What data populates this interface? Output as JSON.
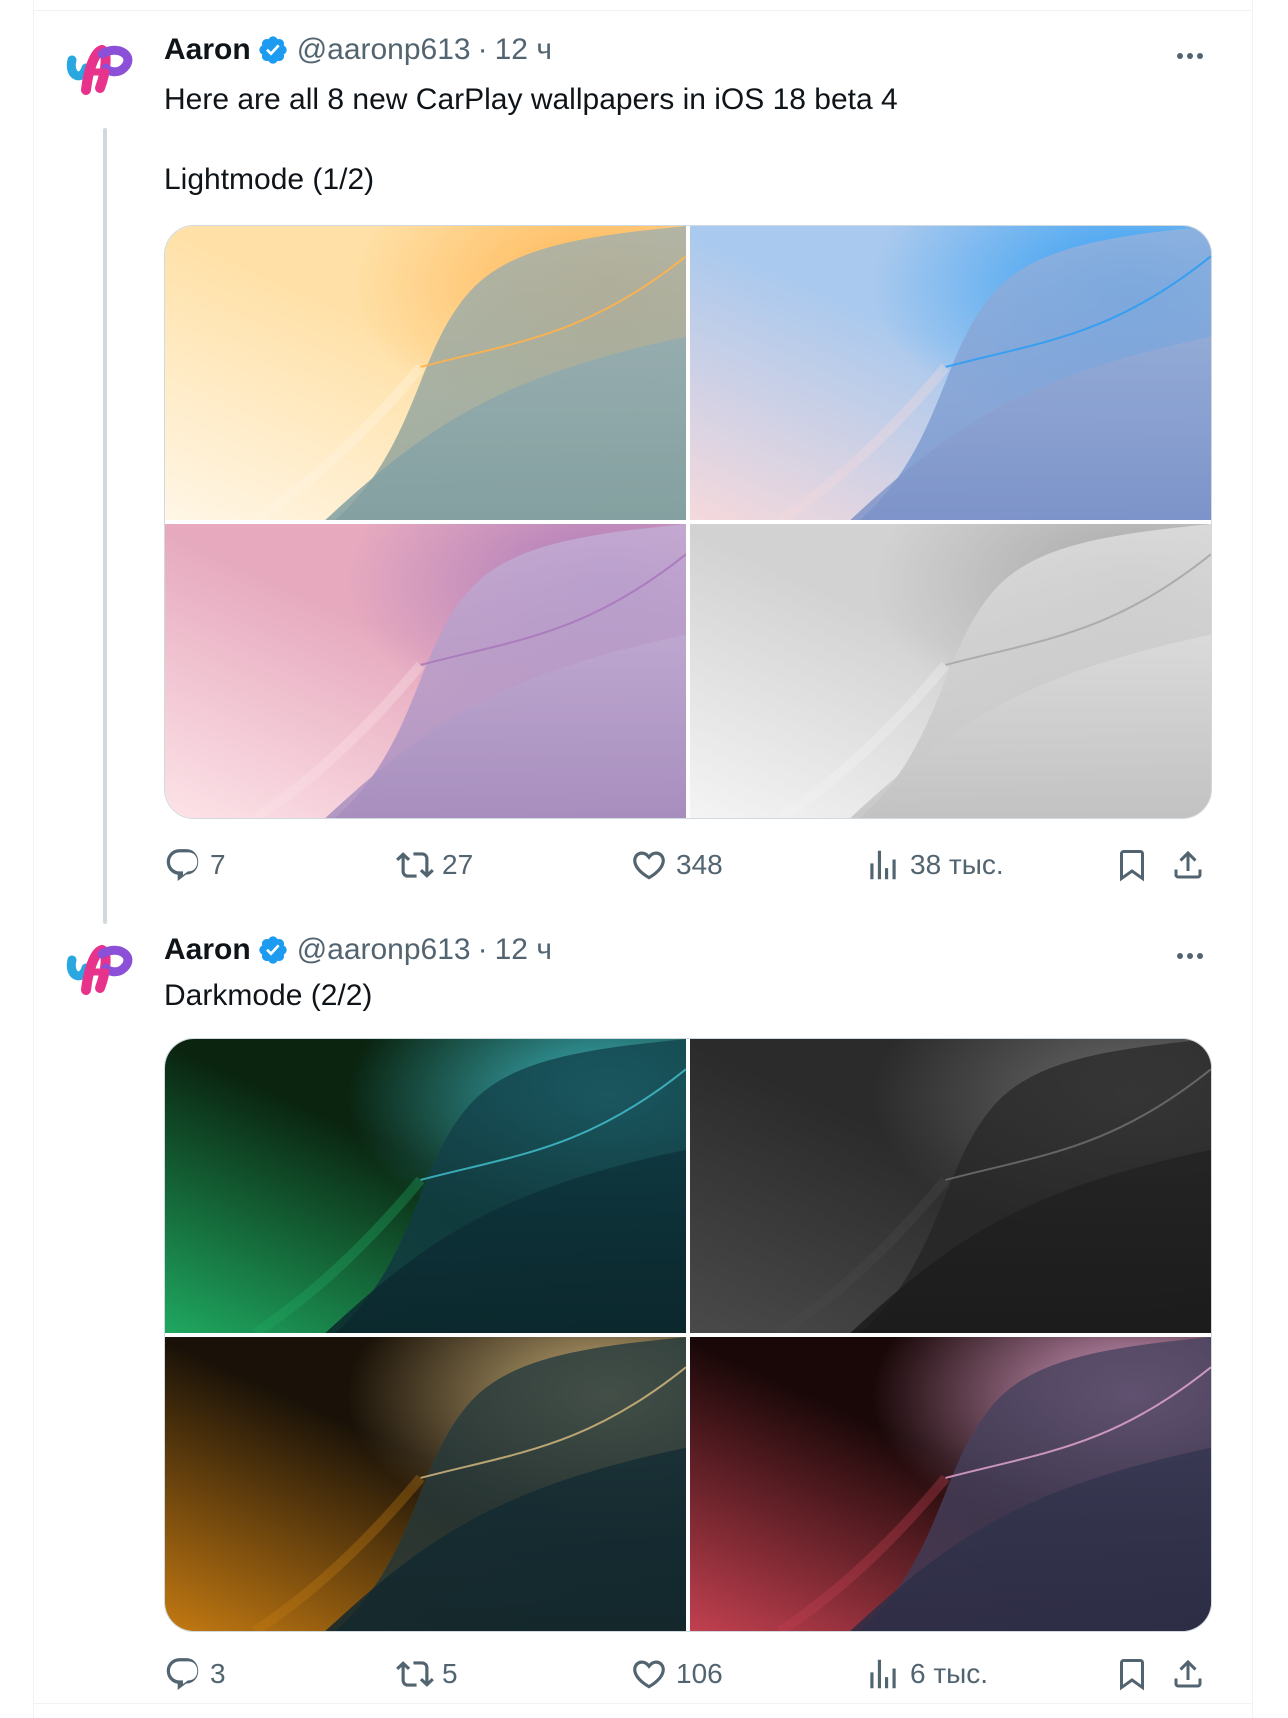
{
  "tweets": [
    {
      "author_name": "Aaron",
      "handle": "@aaronp613",
      "separator": "·",
      "time": "12 ч",
      "text": "Here are all 8 new CarPlay wallpapers in iOS 18 beta 4\n\nLightmode (1/2)",
      "wallpapers": [
        {
          "label": "Lightmode orange wallpaper",
          "colors": [
            "#ffe1a8",
            "#ffb24e",
            "#9ab1b8",
            "#7f9ea0",
            "#fff6e6"
          ]
        },
        {
          "label": "Lightmode blue wallpaper",
          "colors": [
            "#a9c9ee",
            "#2e9df3",
            "#9fb4da",
            "#7c92c8",
            "#f5d9dc"
          ]
        },
        {
          "label": "Lightmode purple wallpaper",
          "colors": [
            "#e6a9be",
            "#a879bb",
            "#c6b4d8",
            "#a68dbd",
            "#fde3e8"
          ]
        },
        {
          "label": "Lightmode gray wallpaper",
          "colors": [
            "#d2d2d2",
            "#a7a7a7",
            "#e6e6e6",
            "#c2c2c2",
            "#f4f4f4"
          ]
        }
      ],
      "stats": {
        "replies": "7",
        "reposts": "27",
        "likes": "348",
        "views": "38 тыс."
      }
    },
    {
      "author_name": "Aaron",
      "handle": "@aaronp613",
      "separator": "·",
      "time": "12 ч",
      "text": "Darkmode (2/2)",
      "wallpapers": [
        {
          "label": "Darkmode teal wallpaper",
          "colors": [
            "#0a2410",
            "#3fb7c4",
            "#0f3a43",
            "#0a252b",
            "#1fa860"
          ]
        },
        {
          "label": "Darkmode gray wallpaper",
          "colors": [
            "#2b2b2b",
            "#6b6b6b",
            "#262626",
            "#1a1a1a",
            "#4a4a4a"
          ]
        },
        {
          "label": "Darkmode amber wallpaper",
          "colors": [
            "#1a1208",
            "#c9b07a",
            "#173038",
            "#10262c",
            "#c47a12"
          ]
        },
        {
          "label": "Darkmode rose wallpaper",
          "colors": [
            "#1a0808",
            "#d9a0c8",
            "#3a3a55",
            "#2a2c44",
            "#c24050"
          ]
        }
      ],
      "stats": {
        "replies": "3",
        "reposts": "5",
        "likes": "106",
        "views": "6 тыс."
      }
    }
  ],
  "theme": {
    "verified_color": "#1d9bf0",
    "text_secondary": "#536471",
    "border": "#cfd9de"
  },
  "icons": [
    "verified-badge-icon",
    "more-icon",
    "reply-icon",
    "repost-icon",
    "like-icon",
    "views-icon",
    "bookmark-icon",
    "share-icon"
  ]
}
